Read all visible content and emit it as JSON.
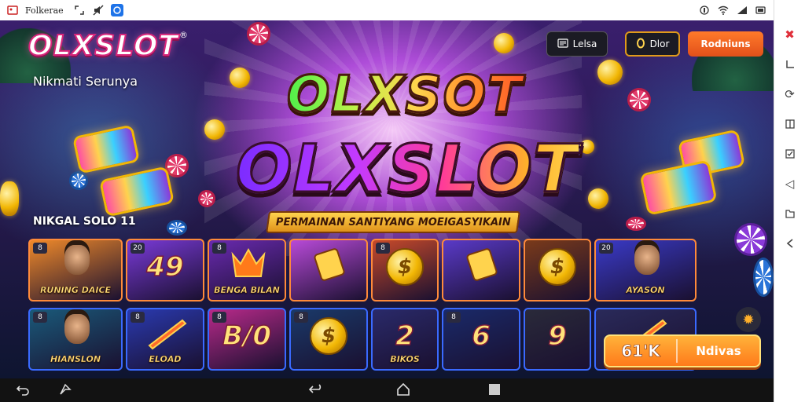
{
  "statusbar": {
    "app_title": "Folkerae",
    "icons": [
      "gallery-icon",
      "expand-icon",
      "mute-icon",
      "app-icon",
      "record-icon",
      "wifi-icon",
      "signal-icon",
      "battery-icon"
    ]
  },
  "brand": {
    "logo": "OLXSLOT",
    "registered": "®",
    "tagline": "Nikmati Serunya"
  },
  "header_buttons": {
    "first": {
      "label": "Lelsa"
    },
    "second": {
      "label": "Dlor"
    },
    "register": {
      "label": "Rodniuns"
    }
  },
  "hero": {
    "line1": "OLXSOT",
    "line2": "OLXSLOT",
    "subtitle": "PERMAINAN SANTIYANG MOEIGASYIKAIN"
  },
  "section": {
    "label": "NIKGAL SOLO 11"
  },
  "games": [
    {
      "id": "g1",
      "badge": "8",
      "title": "RUNING DAICE",
      "big": "",
      "theme": "face",
      "bg": "#f08a2a"
    },
    {
      "id": "g2",
      "badge": "20",
      "title": "",
      "big": "49",
      "theme": "text",
      "bg": "#7a3ad8"
    },
    {
      "id": "g3",
      "badge": "8",
      "title": "BENGA BILAN",
      "big": "",
      "theme": "demon",
      "bg": "#6a2ab0"
    },
    {
      "id": "g4",
      "badge": "",
      "title": "",
      "big": "",
      "theme": "card",
      "bg": "#b84ad8"
    },
    {
      "id": "g5",
      "badge": "8",
      "title": "",
      "big": "",
      "theme": "coin",
      "bg": "#c84a2a"
    },
    {
      "id": "g6",
      "badge": "",
      "title": "",
      "big": "",
      "theme": "card",
      "bg": "#5a3ac8"
    },
    {
      "id": "g7",
      "badge": "",
      "title": "",
      "big": "",
      "theme": "coin",
      "bg": "#7a3a1a"
    },
    {
      "id": "g8",
      "badge": "20",
      "title": "AYASON",
      "big": "",
      "theme": "face",
      "bg": "#3a3ac8"
    },
    {
      "id": "g9",
      "badge": "8",
      "title": "HIANSLON",
      "big": "",
      "theme": "face",
      "bg": "#1a5a7a"
    },
    {
      "id": "g10",
      "badge": "8",
      "title": "ELOAD",
      "big": "",
      "theme": "sword",
      "bg": "#2a3ab0"
    },
    {
      "id": "g11",
      "badge": "8",
      "title": "",
      "big": "B/0",
      "theme": "text",
      "bg": "#b82a8a"
    },
    {
      "id": "g12",
      "badge": "8",
      "title": "",
      "big": "",
      "theme": "coin",
      "bg": "#1a3a6a"
    },
    {
      "id": "g13",
      "badge": "",
      "title": "BIKOS",
      "big": "2",
      "theme": "text",
      "bg": "#2a2a6a"
    },
    {
      "id": "g14",
      "badge": "8",
      "title": "",
      "big": "6",
      "theme": "text",
      "bg": "#1a2a6a"
    },
    {
      "id": "g15",
      "badge": "",
      "title": "",
      "big": "9",
      "theme": "text",
      "bg": "#2a2a3a"
    },
    {
      "id": "g16",
      "badge": "",
      "title": "",
      "big": "",
      "theme": "sword",
      "bg": "#2a2a5a"
    }
  ],
  "cta": {
    "value": "61'K",
    "label": "Ndivas"
  },
  "colors": {
    "accent": "#ff7a1a",
    "brand_pink": "#d8267a",
    "gold": "#f2b705"
  },
  "rail_icons": [
    "collapse-icon",
    "corner-icon",
    "rotate-icon",
    "split-icon",
    "check-icon",
    "volume-icon",
    "folder-icon",
    "back-arrow-icon"
  ],
  "navbar_icons": [
    "undo-icon",
    "share-icon",
    "back-icon",
    "home-icon",
    "recents-icon"
  ]
}
